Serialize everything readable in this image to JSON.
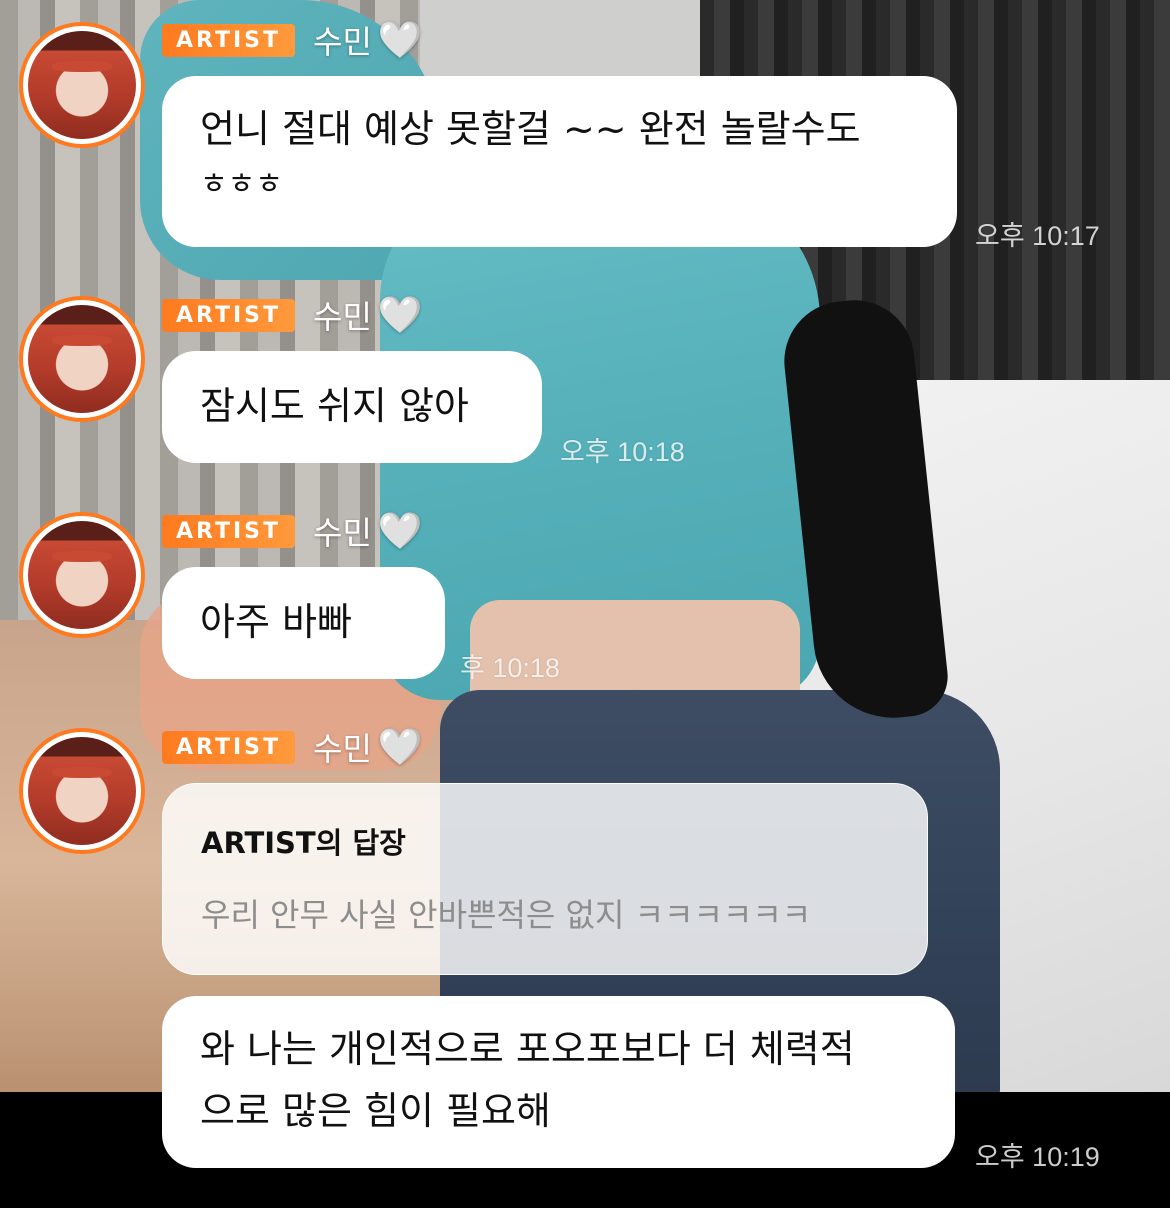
{
  "colors": {
    "accent": "#ff7a1f",
    "bubble": "#ffffff",
    "reply_text": "#8d8d8d"
  },
  "messages": [
    {
      "badge": "ARTIST",
      "sender": "수민",
      "heart_icon": "white-heart-icon",
      "heart": "🤍",
      "text_line1": "언니 절대 예상 못할걸 ~~ 완전 놀랄수도",
      "text_line2": "ㅎㅎㅎ",
      "time": "오후 10:17"
    },
    {
      "badge": "ARTIST",
      "sender": "수민",
      "heart_icon": "white-heart-icon",
      "heart": "🤍",
      "text": "잠시도 쉬지 않아",
      "time": "오후 10:18"
    },
    {
      "badge": "ARTIST",
      "sender": "수민",
      "heart_icon": "white-heart-icon",
      "heart": "🤍",
      "text": "아주 바빠",
      "time": "후 10:18"
    },
    {
      "badge": "ARTIST",
      "sender": "수민",
      "heart_icon": "white-heart-icon",
      "heart": "🤍",
      "reply_title": "ARTIST의 답장",
      "reply_text": "우리 안무 사실 안바쁜적은 없지 ㅋㅋㅋㅋㅋㅋ",
      "text_line1": "와 나는 개인적으로 포오포보다 더 체력적",
      "text_line2": "으로 많은 힘이 필요해",
      "time": "오후 10:19"
    }
  ]
}
